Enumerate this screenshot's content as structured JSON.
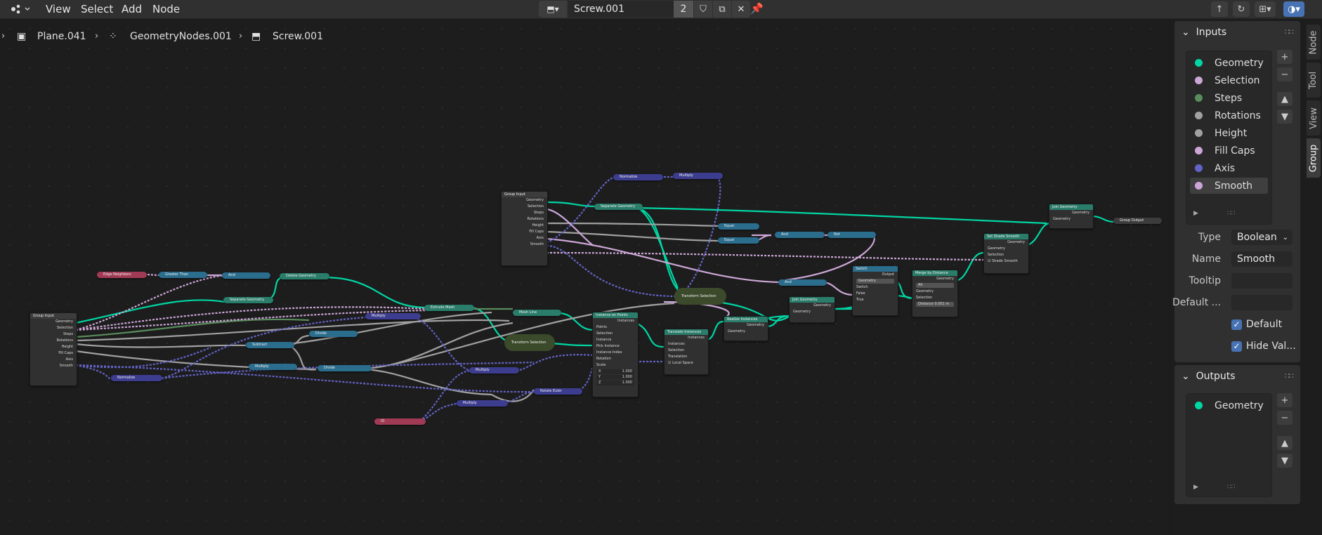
{
  "header": {
    "menu": [
      "View",
      "Select",
      "Add",
      "Node"
    ],
    "tree_name": "Screw.001",
    "tree_users": "2"
  },
  "breadcrumb": [
    "Plane.041",
    "GeometryNodes.001",
    "Screw.001"
  ],
  "sidebar": {
    "tabs": [
      "Node",
      "Tool",
      "View",
      "Group"
    ],
    "active_tab": "Group",
    "inputs_panel": {
      "title": "Inputs",
      "items": [
        {
          "label": "Geometry",
          "color": "#00d6a3"
        },
        {
          "label": "Selection",
          "color": "#cca6d6"
        },
        {
          "label": "Steps",
          "color": "#598c5c"
        },
        {
          "label": "Rotations",
          "color": "#a1a1a1"
        },
        {
          "label": "Height",
          "color": "#a1a1a1"
        },
        {
          "label": "Fill Caps",
          "color": "#cca6d6"
        },
        {
          "label": "Axis",
          "color": "#6363c7"
        },
        {
          "label": "Smooth",
          "color": "#cca6d6"
        }
      ],
      "selected": "Smooth"
    },
    "properties": {
      "type_label": "Type",
      "type_value": "Boolean",
      "name_label": "Name",
      "name_value": "Smooth",
      "tooltip_label": "Tooltip",
      "tooltip_value": "",
      "default_label": "Default ...",
      "default_value": "",
      "default_cb": "Default",
      "hide_cb": "Hide Val..."
    },
    "outputs_panel": {
      "title": "Outputs",
      "items": [
        {
          "label": "Geometry",
          "color": "#00d6a3"
        }
      ]
    }
  },
  "nodes": {
    "group_input_1": {
      "title": "Group Input",
      "sockets": [
        "Geometry",
        "Selection",
        "Steps",
        "Rotations",
        "Height",
        "Fill Caps",
        "Axis",
        "Smooth"
      ]
    },
    "group_input_2": {
      "title": "Group Input",
      "sockets": [
        "Geometry",
        "Selection",
        "Steps",
        "Rotations",
        "Height",
        "Fill Caps",
        "Axis",
        "Smooth"
      ]
    },
    "edge_neighbors": "Edge Neighbors",
    "greater_than": "Greater Than",
    "and_1": "And",
    "delete_geometry": "Delete Geometry",
    "separate_geometry_1": "Separate Geometry",
    "extrude_mesh": "Extrude Mesh",
    "multiply_1": "Multiply",
    "divide_1": "Divide",
    "subtract": "Subtract",
    "multiply_2": "Multiply",
    "divide_2": "Divide",
    "normalize_1": "Normalize",
    "mesh_line": "Mesh Line",
    "transform_selection_1": "Transform Selection",
    "multiply_3": "Multiply",
    "multiply_4": "Multiply",
    "rotate_euler": "Rotate Euler",
    "id": "ID",
    "instance_on_points": {
      "title": "Instance on Points",
      "rows": [
        "Instances",
        "Points",
        "Selection",
        "Instance",
        "Pick Instance",
        "Instance Index",
        "Rotation",
        "Scale"
      ],
      "scale_x": "X",
      "scale_y": "Y",
      "scale_z": "Z",
      "scale_val": "1.000"
    },
    "translate_instances": {
      "title": "Translate Instances",
      "rows": [
        "Instances",
        "Instances",
        "Selection",
        "Translation"
      ],
      "local": "Local Space"
    },
    "realize_instances": {
      "title": "Realize Instances",
      "rows": [
        "Geometry",
        "Geometry"
      ]
    },
    "normalize_2": "Normalize",
    "multiply_5": "Multiply",
    "separate_geometry_2": "Separate Geometry",
    "equal_1": "Equal",
    "equal_2": "Equal",
    "and_2": "And",
    "not": "Not",
    "and_3": "And",
    "transform_selection_2": "Transform Selection",
    "join_geometry_1": {
      "title": "Join Geometry",
      "rows": [
        "Geometry",
        "Geometry"
      ]
    },
    "switch": {
      "title": "Switch",
      "rows": [
        "Output",
        "Geometry",
        "Switch",
        "False",
        "True"
      ]
    },
    "merge_by_distance": {
      "title": "Merge by Distance",
      "rows": [
        "Geometry",
        "All",
        "Geometry",
        "Selection"
      ],
      "distance": "Distance  0.001 m"
    },
    "set_shade_smooth": {
      "title": "Set Shade Smooth",
      "rows": [
        "Geometry",
        "Geometry",
        "Selection",
        "Shade Smooth"
      ]
    },
    "join_geometry_2": {
      "title": "Join Geometry",
      "rows": [
        "Geometry",
        "Geometry"
      ]
    },
    "group_output": "Group Output"
  }
}
